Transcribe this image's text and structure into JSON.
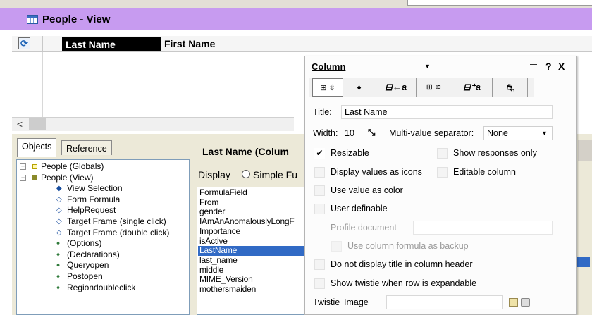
{
  "window": {
    "title": "People - View"
  },
  "view": {
    "columns": [
      "Last Name",
      "First Name"
    ],
    "scroll_left_label": "<"
  },
  "left_panel": {
    "tabs": [
      "Objects",
      "Reference"
    ],
    "tree": [
      {
        "label": "People (Globals)",
        "expander": "+",
        "level": 0,
        "icon": "yellow-square"
      },
      {
        "label": "People (View)",
        "expander": "−",
        "level": 0,
        "icon": "olive-square"
      },
      {
        "label": "View Selection",
        "level": 1,
        "icon": "diamond-filled"
      },
      {
        "label": "Form Formula",
        "level": 1,
        "icon": "diamond-outline"
      },
      {
        "label": "HelpRequest",
        "level": 1,
        "icon": "diamond-outline"
      },
      {
        "label": "Target Frame (single click)",
        "level": 1,
        "icon": "diamond-outline"
      },
      {
        "label": "Target Frame (double click)",
        "level": 1,
        "icon": "diamond-outline"
      },
      {
        "label": "(Options)",
        "level": 1,
        "icon": "script"
      },
      {
        "label": "(Declarations)",
        "level": 1,
        "icon": "script"
      },
      {
        "label": "Queryopen",
        "level": 1,
        "icon": "script"
      },
      {
        "label": "Postopen",
        "level": 1,
        "icon": "script"
      },
      {
        "label": "Regiondoubleclick",
        "level": 1,
        "icon": "script"
      }
    ]
  },
  "middle_panel": {
    "title": "Last Name (Colum",
    "display_label": "Display",
    "simple_label": "Simple Fu",
    "fields": [
      "FormulaField",
      "From",
      "gender",
      "IAmAnAnomalouslyLongF",
      "Importance",
      "isActive",
      "LastName",
      "last_name",
      "middle",
      "MIME_Version",
      "mothersmaiden"
    ],
    "selected_field": "LastName"
  },
  "dialog": {
    "title": "Column",
    "buttons": {
      "help": "?",
      "close": "X"
    },
    "tab_glyphs": [
      "⊞ ⇳",
      "♦",
      "⊟←a",
      "⊞ ≋",
      "⊟⁺a",
      "⛐"
    ],
    "title_label": "Title:",
    "title_value": "Last Name",
    "width_label": "Width:",
    "width_value": "10",
    "multi_label": "Multi-value separator:",
    "multi_value": "None",
    "checks": {
      "resizable": {
        "label": "Resizable",
        "checked": true
      },
      "show_responses": {
        "label": "Show responses only",
        "checked": false
      },
      "display_icons": {
        "label": "Display values as icons",
        "checked": false
      },
      "editable": {
        "label": "Editable column",
        "checked": false
      },
      "value_color": {
        "label": "Use value as color",
        "checked": false
      },
      "user_definable": {
        "label": "User definable",
        "checked": false
      },
      "profile_doc": {
        "label": "Profile document"
      },
      "use_formula": {
        "label": "Use column formula as backup",
        "checked": false
      },
      "no_title": {
        "label": "Do not display title in column header",
        "checked": false
      },
      "show_twistie": {
        "label": "Show twistie when row is expandable",
        "checked": false
      }
    },
    "twistie_label": "Twistie",
    "image_label": "Image"
  },
  "colors": {
    "titlebar": "#c79bf0",
    "selection": "#316ac5",
    "panel_bg": "#ece9d8"
  }
}
